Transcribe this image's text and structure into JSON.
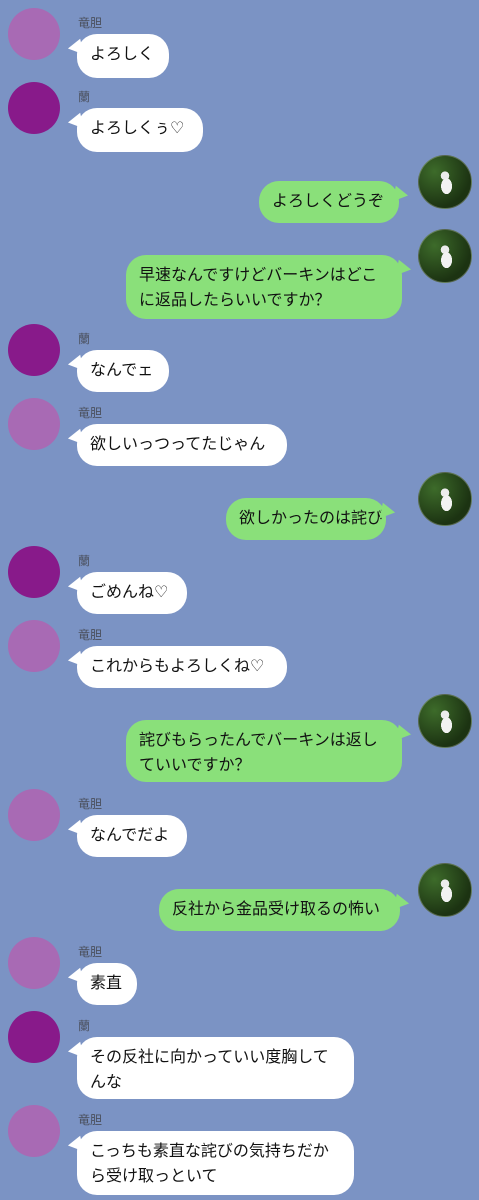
{
  "colors": {
    "background": "#7b93c4",
    "incoming_bubble": "#ffffff",
    "outgoing_bubble": "#8ae07a",
    "avatar_ryudan": "#a86ab4",
    "avatar_ran": "#881a8a"
  },
  "messages": [
    {
      "side": "in",
      "sender": "竜胆",
      "avatar": "avatar-ryudan",
      "text": "よろしく"
    },
    {
      "side": "in",
      "sender": "蘭",
      "avatar": "avatar-ran",
      "text": "よろしくぅ♡"
    },
    {
      "side": "out",
      "avatar": "cat-photo-avatar",
      "text": "よろしくどうぞ"
    },
    {
      "side": "out",
      "avatar": "cat-photo-avatar",
      "text": "早速なんですけどバーキンはどこ\nに返品したらいいですか？"
    },
    {
      "side": "in",
      "sender": "蘭",
      "avatar": "avatar-ran",
      "text": "なんでェ"
    },
    {
      "side": "in",
      "sender": "竜胆",
      "avatar": "avatar-ryudan",
      "text": "欲しいっつってたじゃん"
    },
    {
      "side": "out",
      "avatar": "cat-photo-avatar",
      "text": "欲しかったのは詫び"
    },
    {
      "side": "in",
      "sender": "蘭",
      "avatar": "avatar-ran",
      "text": "ごめんね♡"
    },
    {
      "side": "in",
      "sender": "竜胆",
      "avatar": "avatar-ryudan",
      "text": "これからもよろしくね♡"
    },
    {
      "side": "out",
      "avatar": "cat-photo-avatar",
      "text": "詫びもらったんでバーキンは返し\nていいですか？"
    },
    {
      "side": "in",
      "sender": "竜胆",
      "avatar": "avatar-ryudan",
      "text": "なんでだよ"
    },
    {
      "side": "out",
      "avatar": "cat-photo-avatar",
      "text": "反社から金品受け取るの怖い"
    },
    {
      "side": "in",
      "sender": "竜胆",
      "avatar": "avatar-ryudan",
      "text": "素直"
    },
    {
      "side": "in",
      "sender": "蘭",
      "avatar": "avatar-ran",
      "text": "その反社に向かっていい度胸して\nんな"
    },
    {
      "side": "in",
      "sender": "竜胆",
      "avatar": "avatar-ryudan",
      "text": "こっちも素直な詫びの気持ちだか\nら受け取っといて"
    }
  ]
}
